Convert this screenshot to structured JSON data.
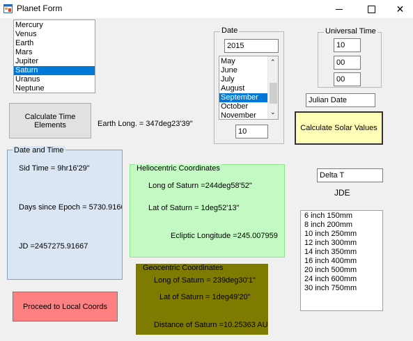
{
  "window": {
    "title": "Planet Form"
  },
  "planet_list": [
    "Mercury",
    "Venus",
    "Earth",
    "Mars",
    "Jupiter",
    "Saturn",
    "Uranus",
    "Neptune"
  ],
  "planet_selected": 5,
  "buttons": {
    "calc_time": "Calculate Time Elements",
    "calc_solar": "Calculate Solar Values",
    "proceed_local": "Proceed to Local Coords"
  },
  "earth_long": "Earth Long. = 347deg23'39\"",
  "date_group": {
    "legend": "Date",
    "year": "2015",
    "months": [
      "May",
      "June",
      "July",
      "August",
      "September",
      "October",
      "November"
    ],
    "month_selected": 4,
    "day": "10"
  },
  "ut_group": {
    "legend": "Universal Time",
    "hour": "10",
    "minute": "00",
    "second": "00"
  },
  "julian_date": "Julian Date",
  "delta_t": "Delta T",
  "jde": "JDE",
  "dt_group": {
    "legend": "Date and Time",
    "sid_time": "Sid Time = 9hr16'29\"",
    "days_since_epoch": "Days since Epoch = 5730.9166",
    "jd": "JD =2457275.91667"
  },
  "helio": {
    "legend": "Heliocentric Coordinates",
    "long": "Long of Saturn =244deg58'52\"",
    "lat": "Lat of Saturn =  1deg52'13\"",
    "ecliptic": "Ecliptic Longitude =245.007959"
  },
  "geo": {
    "legend": "Geocentric Coordinates",
    "long": "Long of Saturn =  239deg30'1\"",
    "lat": "Lat of Saturn =  1deg49'20\"",
    "distance": "Distance of Saturn =10.25363 AU"
  },
  "telescope_list": [
    "6 inch  150mm",
    "8 inch  200mm",
    "10 inch  250mm",
    "12 inch  300mm",
    "14 inch  350mm",
    "16 inch  400mm",
    "20 inch  500mm",
    "24 inch  600mm",
    "30 inch  750mm"
  ],
  "colors": {
    "selection": "#0078d7",
    "dt_bg": "#dae6f3",
    "dt_border": "#7da2ce",
    "helio_bg": "#c3fac3",
    "helio_border": "#8ee58e",
    "geo_bg": "#7f7b00",
    "solar_btn": "#fffdb6",
    "proceed_btn": "#ff8080"
  }
}
